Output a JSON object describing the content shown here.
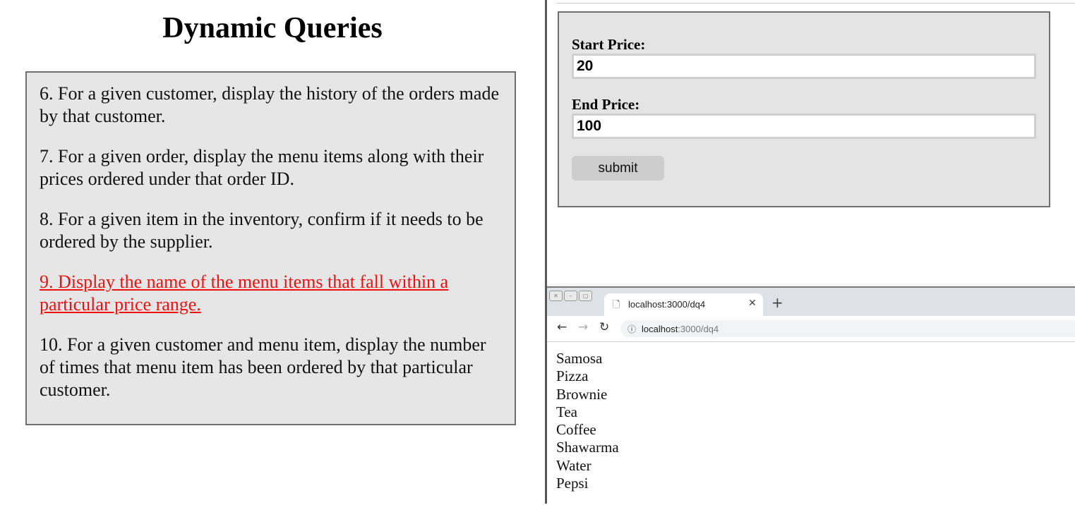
{
  "left": {
    "title": "Dynamic Queries",
    "queries": [
      {
        "text": "6. For a given customer, display the history of the orders made by that customer."
      },
      {
        "text": "7. For a given order, display the menu items along with their prices ordered under that order ID."
      },
      {
        "text": "8. For a given item in the inventory, confirm if it needs to be ordered by the supplier."
      },
      {
        "text": "9. Display the name of the menu items that fall within a particular price range. ",
        "active": true
      },
      {
        "text": "10. For a given customer and menu item, display the number of times that menu item has been ordered by that particular customer."
      }
    ],
    "active_color": "#ee1111"
  },
  "form": {
    "start_label": "Start Price:",
    "start_value": "20",
    "end_label": "End Price:",
    "end_value": "100",
    "submit_label": "submit"
  },
  "browser": {
    "tab_title": "localhost:3000/dq4",
    "url_host": "localhost",
    "url_path": ":3000/dq4",
    "icons": {
      "tab": "page-icon",
      "close": "close-icon",
      "new_tab": "plus-icon",
      "back": "back-arrow-icon",
      "forward": "forward-arrow-icon",
      "reload": "reload-icon",
      "info": "info-icon"
    },
    "results": [
      "Samosa",
      "Pizza",
      "Brownie",
      "Tea",
      "Coffee",
      "Shawarma",
      "Water",
      "Pepsi"
    ]
  }
}
